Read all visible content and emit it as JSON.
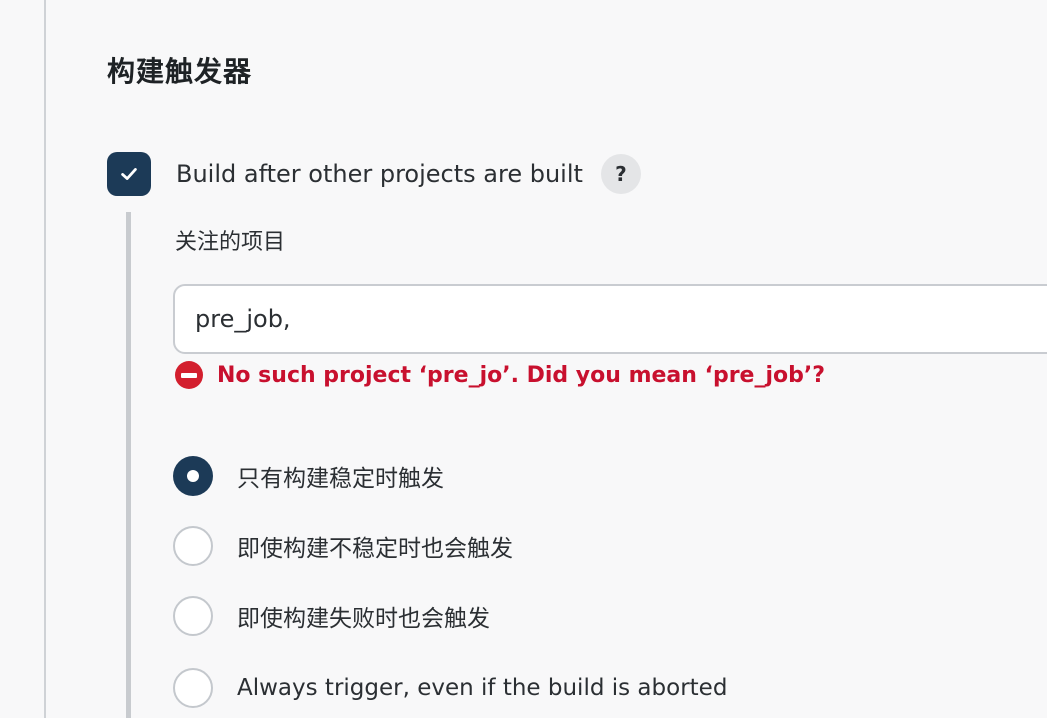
{
  "section": {
    "title": "构建触发器"
  },
  "trigger": {
    "checkbox_label": "Build after other projects are built",
    "checked": true,
    "help_label": "?"
  },
  "projects_field": {
    "label": "关注的项目",
    "value": "pre_job,"
  },
  "error": {
    "message": "No such project ‘pre_jo’. Did you mean ‘pre_job’?"
  },
  "radio_options": [
    {
      "label": "只有构建稳定时触发",
      "selected": true
    },
    {
      "label": "即使构建不稳定时也会触发",
      "selected": false
    },
    {
      "label": "即使构建失败时也会触发",
      "selected": false
    },
    {
      "label": "Always trigger, even if the build is aborted",
      "selected": false
    }
  ],
  "colors": {
    "accent": "#1c3a57",
    "error": "#c8102e",
    "background": "#f8f8f9"
  }
}
